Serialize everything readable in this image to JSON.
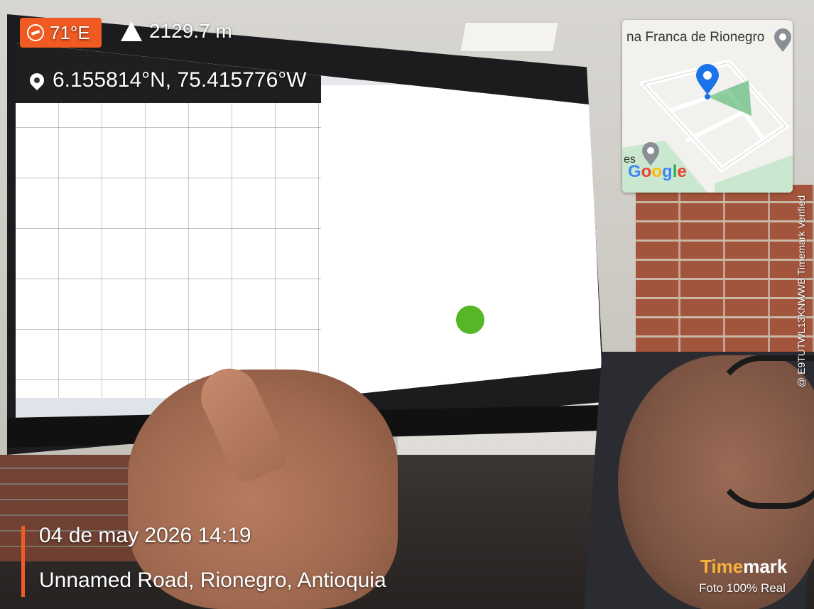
{
  "overlay": {
    "compass": "71°E",
    "altitude": "2129.7 m",
    "coordinates": "6.155814°N, 75.415776°W",
    "date_time": "04 de may 2026 14:19",
    "address": "Unnamed Road, Rionegro, Antioquia",
    "verification_code": "@ E9TUTWL13KNWWB   Timemark Verified",
    "brand_part1": "Time",
    "brand_part2": "mark",
    "brand_subtitle": "Foto 100% Real",
    "accent_color": "#f15a22"
  },
  "map": {
    "place_label": "na Franca de Rionegro",
    "partial_label": "es",
    "google_letters": [
      "G",
      "o",
      "o",
      "g",
      "l",
      "e"
    ],
    "pin_color": "#1a73e8"
  },
  "icons": [
    "compass-icon",
    "mountain-icon",
    "location-pin-icon",
    "map-pin-icon"
  ]
}
